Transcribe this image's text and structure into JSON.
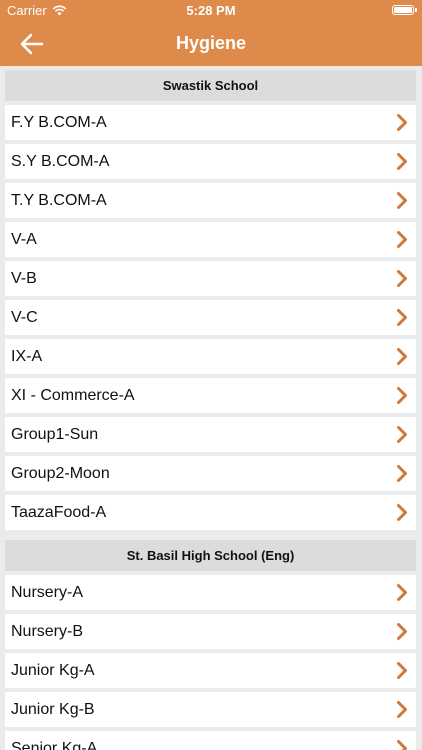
{
  "status_bar": {
    "carrier": "Carrier",
    "time": "5:28 PM"
  },
  "nav": {
    "title": "Hygiene"
  },
  "sections": [
    {
      "title": "Swastik School",
      "items": [
        "F.Y B.COM-A",
        "S.Y B.COM-A",
        "T.Y B.COM-A",
        "V-A",
        "V-B",
        "V-C",
        "IX-A",
        "XI - Commerce-A",
        "Group1-Sun",
        "Group2-Moon",
        "TaazaFood-A"
      ]
    },
    {
      "title": "St. Basil High School (Eng)",
      "items": [
        "Nursery-A",
        "Nursery-B",
        "Junior Kg-A",
        "Junior Kg-B",
        "Senior Kg-A"
      ]
    }
  ],
  "colors": {
    "accent": "#de8a4a",
    "chevron": "#d0783a"
  }
}
